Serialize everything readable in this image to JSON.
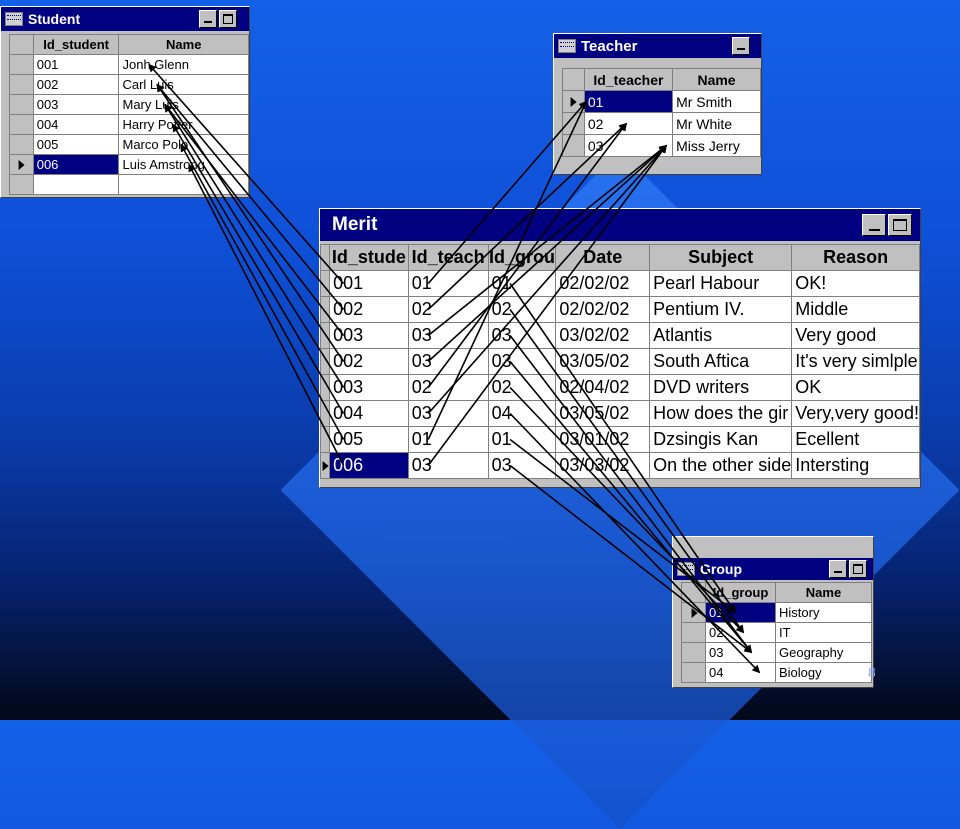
{
  "student_window": {
    "title": "Student",
    "columns": [
      "Id_student",
      "Name"
    ],
    "rows": [
      {
        "id": "001",
        "name": "Jonh Glenn",
        "selected": false
      },
      {
        "id": "002",
        "name": "Carl Luis",
        "selected": false
      },
      {
        "id": "003",
        "name": "Mary Luis",
        "selected": false
      },
      {
        "id": "004",
        "name": "Harry Potter",
        "selected": false
      },
      {
        "id": "005",
        "name": "Marco Polo",
        "selected": false
      },
      {
        "id": "006",
        "name": "Luis Amstrong",
        "selected": true
      }
    ]
  },
  "teacher_window": {
    "title": "Teacher",
    "columns": [
      "Id_teacher",
      "Name"
    ],
    "rows": [
      {
        "id": "01",
        "name": "Mr Smith",
        "selected": true
      },
      {
        "id": "02",
        "name": "Mr White",
        "selected": false
      },
      {
        "id": "03",
        "name": "Miss Jerry",
        "selected": false
      }
    ]
  },
  "merit_window": {
    "title": "Merit",
    "columns": [
      "Id_stude",
      "Id_teach",
      "Id_grou",
      "Date",
      "Subject",
      "Reason"
    ],
    "rows": [
      {
        "student": "001",
        "teacher": "01",
        "group": "01",
        "date": "02/02/02",
        "subject": "Pearl Habour",
        "reason": "OK!",
        "selected": false
      },
      {
        "student": "002",
        "teacher": "02",
        "group": "02",
        "date": "02/02/02",
        "subject": "Pentium IV.",
        "reason": "Middle",
        "selected": false
      },
      {
        "student": "003",
        "teacher": "03",
        "group": "03",
        "date": "03/02/02",
        "subject": "Atlantis",
        "reason": "Very good",
        "selected": false
      },
      {
        "student": "002",
        "teacher": "03",
        "group": "03",
        "date": "03/05/02",
        "subject": "South Aftica",
        "reason": "It's very simlple",
        "selected": false
      },
      {
        "student": "003",
        "teacher": "02",
        "group": "02",
        "date": "02/04/02",
        "subject": "DVD writers",
        "reason": "OK",
        "selected": false
      },
      {
        "student": "004",
        "teacher": "03",
        "group": "04",
        "date": "03/05/02",
        "subject": "How does the gir",
        "reason": "Very,very good!",
        "selected": false
      },
      {
        "student": "005",
        "teacher": "01",
        "group": "01",
        "date": "03/01/02",
        "subject": "Dzsingis Kan",
        "reason": "Ecellent",
        "selected": false
      },
      {
        "student": "006",
        "teacher": "03",
        "group": "03",
        "date": "03/03/02",
        "subject": "On the other side",
        "reason": "Intersting",
        "selected": true
      }
    ]
  },
  "group_window": {
    "title": "Group",
    "columns": [
      "Id_group",
      "Name"
    ],
    "rows": [
      {
        "id": "01",
        "name": "History",
        "selected": true
      },
      {
        "id": "02",
        "name": "IT",
        "selected": false
      },
      {
        "id": "03",
        "name": "Geography",
        "selected": false
      },
      {
        "id": "04",
        "name": "Biology",
        "selected": false
      }
    ]
  },
  "page_number": "8",
  "colors": {
    "title_bar": "#000080",
    "selection": "#000080",
    "window": "#c0c0c0"
  }
}
